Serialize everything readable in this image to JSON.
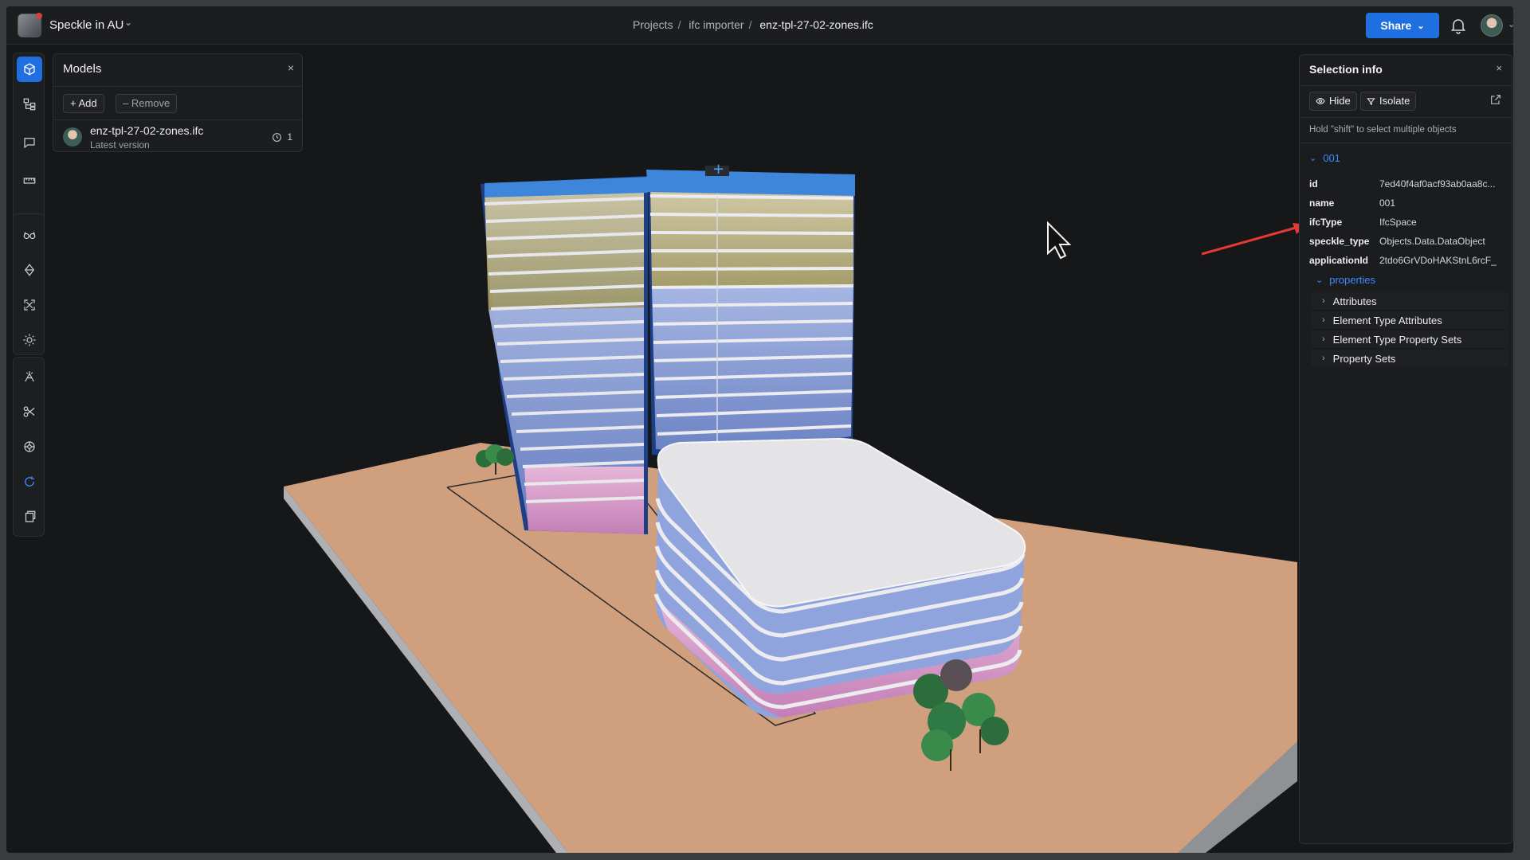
{
  "topbar": {
    "workspace_name": "Speckle in AU",
    "breadcrumb": [
      "Projects",
      "ifc importer",
      "enz-tpl-27-02-zones.ifc"
    ],
    "share_label": "Share"
  },
  "rail": {
    "items": [
      "model-icon",
      "scene-explorer-icon",
      "discussions-icon",
      "measure-icon",
      "view-modes-icon",
      "lighting-icon",
      "zoom-extents-icon",
      "sun-icon",
      "explode-icon",
      "section-icon",
      "filters-icon",
      "sync-icon",
      "screenshot-icon"
    ],
    "active": "model-icon"
  },
  "models_panel": {
    "title": "Models",
    "close": "×",
    "add_label": "+ Add",
    "remove_label": "– Remove",
    "model": {
      "name": "enz-tpl-27-02-zones.ifc",
      "subtitle": "Latest version",
      "versions": "1"
    }
  },
  "selection_panel": {
    "title": "Selection info",
    "close": "×",
    "hide_label": "Hide",
    "isolate_label": "Isolate",
    "hint": "Hold \"shift\" to select multiple objects",
    "section": "001",
    "fields": [
      {
        "key": "id",
        "value": "7ed40f4af0acf93ab0aa8c..."
      },
      {
        "key": "name",
        "value": "001"
      },
      {
        "key": "ifcType",
        "value": "IfcSpace"
      },
      {
        "key": "speckle_type",
        "value": "Objects.Data.DataObject"
      },
      {
        "key": "applicationId",
        "value": "2tdo6GrVDoHAKStnL6rcF_"
      }
    ],
    "properties_label": "properties",
    "groups": [
      "Attributes",
      "Element Type Attributes",
      "Element Type Property Sets",
      "Property Sets"
    ]
  },
  "colors": {
    "accent": "#1f6fe0",
    "link": "#3b8cff",
    "ground": "#d09f7e",
    "arrow": "#e53935"
  }
}
